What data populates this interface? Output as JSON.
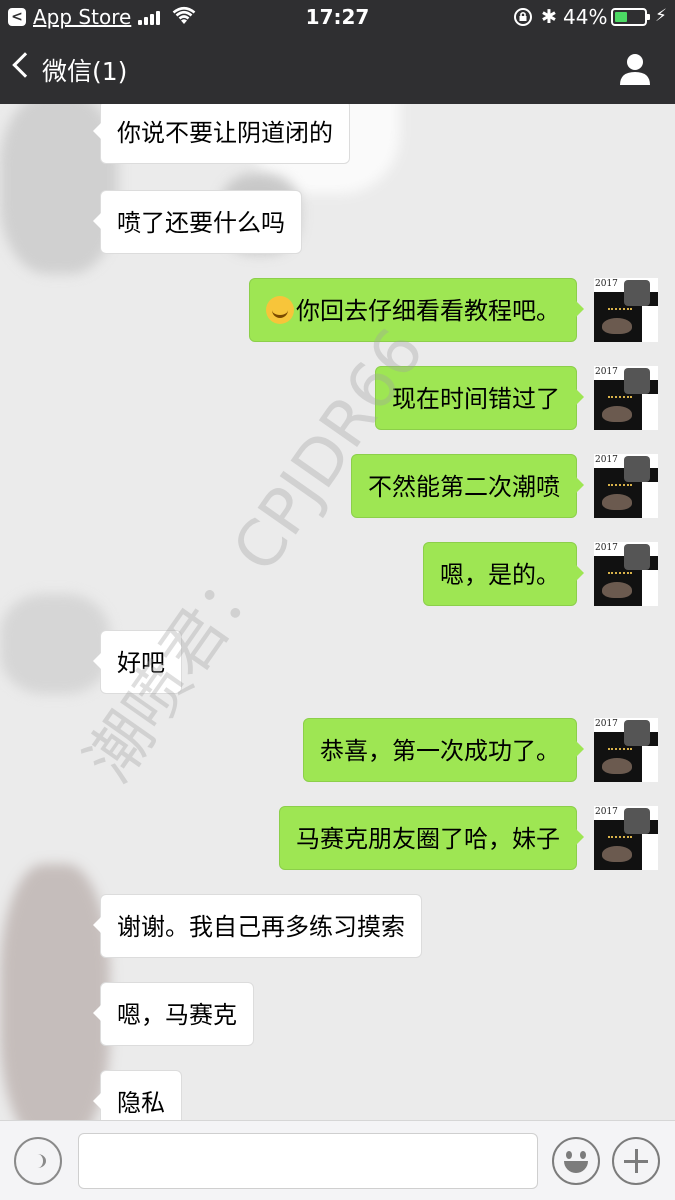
{
  "status_bar": {
    "back_app": "App Store",
    "time": "17:27",
    "battery_percent": "44%",
    "battery_level": 0.44
  },
  "nav": {
    "back_label": "微信(1)"
  },
  "messages": [
    {
      "dir": "in",
      "text": "你说不要让阴道闭的"
    },
    {
      "dir": "in",
      "text": "喷了还要什么吗"
    },
    {
      "dir": "out",
      "emoji": "crying-laughing-emoji",
      "text": "你回去仔细看看教程吧。"
    },
    {
      "dir": "out",
      "text": "现在时间错过了"
    },
    {
      "dir": "out",
      "text": "不然能第二次潮喷"
    },
    {
      "dir": "out",
      "text": "嗯，是的。"
    },
    {
      "dir": "in",
      "text": "好吧"
    },
    {
      "dir": "out",
      "text": "恭喜，第一次成功了。"
    },
    {
      "dir": "out",
      "text": "马赛克朋友圈了哈，妹子"
    },
    {
      "dir": "in",
      "text": "谢谢。我自己再多练习摸索"
    },
    {
      "dir": "in",
      "text": "嗯，马赛克"
    },
    {
      "dir": "in",
      "text": "隐私"
    }
  ],
  "avatar": {
    "year_text": "2017"
  },
  "watermark": "潮喷君：CPJDR66",
  "colors": {
    "header_bg": "#2f2f31",
    "chat_bg": "#ebebeb",
    "out_bubble": "#9ee653",
    "in_bubble": "#ffffff"
  }
}
